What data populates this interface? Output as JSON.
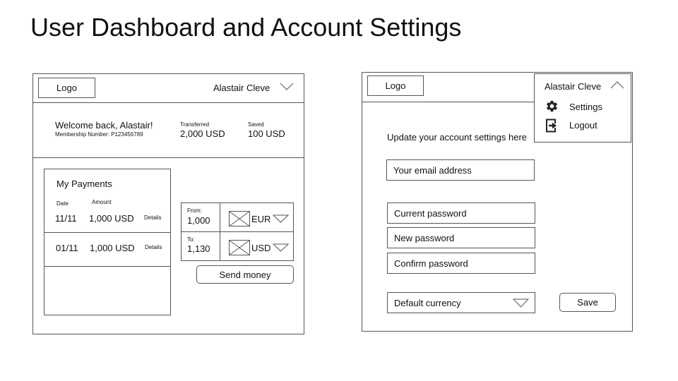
{
  "page_title": "User Dashboard and Account Settings",
  "dashboard": {
    "logo": "Logo",
    "user_name": "Alastair Cleve",
    "welcome": "Welcome back, Alastair!",
    "membership": "Membership Number: P123456789",
    "transferred_label": "Transferred",
    "transferred_value": "2,000 USD",
    "saved_label": "Saved",
    "saved_value": "100 USD",
    "payments": {
      "title": "My Payments",
      "date_header": "Date",
      "amount_header": "Amount",
      "rows": [
        {
          "date": "11/11",
          "amount": "1,000 USD",
          "details": "Details"
        },
        {
          "date": "01/11",
          "amount": "1,000 USD",
          "details": "Details"
        }
      ]
    },
    "converter": {
      "from_label": "From:",
      "from_value": "1,000",
      "from_currency": "EUR",
      "to_label": "To:",
      "to_value": "1,130",
      "to_currency": "USD",
      "send_button": "Send money"
    }
  },
  "settings": {
    "logo": "Logo",
    "user_name": "Alastair Cleve",
    "menu": {
      "settings": "Settings",
      "logout": "Logout"
    },
    "heading": "Update your account settings here",
    "email_placeholder": "Your email address",
    "current_password": "Current password",
    "new_password": "New password",
    "confirm_password": "Confirm password",
    "default_currency": "Default currency",
    "save_button": "Save"
  }
}
